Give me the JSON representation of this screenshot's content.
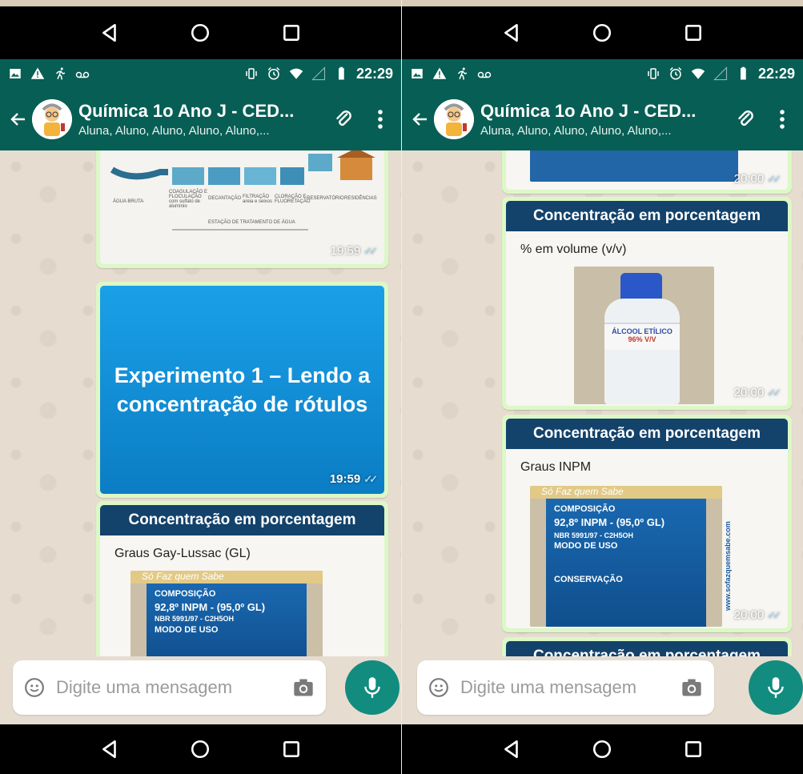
{
  "status": {
    "time": "22:29"
  },
  "chat": {
    "title": "Química 1o Ano J - CED...",
    "subtitle": "Aluna, Aluno, Aluno, Aluno, Aluno,..."
  },
  "left": {
    "messages": [
      {
        "time": "19:59",
        "diagram_labels": [
          "ÁGUA BRUTA",
          "COAGULAÇÃO E FLOCULAÇÃO com sulfato de alumínio",
          "DECANTAÇÃO",
          "FILTRAÇÃO areia e seixos",
          "CLORAÇÃO E FLUORETAÇÃO",
          "RESERVATÓRIO",
          "RESIDÊNCIAS",
          "ESTAÇÃO DE TRATAMENTO DE ÁGUA"
        ]
      },
      {
        "time": "19:59",
        "text_line1": "Experimento 1 – Lendo a",
        "text_line2": "concentração de rótulos"
      },
      {
        "heading": "Concentração em porcentagem",
        "body": "Graus Gay-Lussac (GL)",
        "photo_text_1": "Só Faz quem Sabe",
        "photo_text_2": "COMPOSIÇÃO",
        "photo_text_3": "92,8º INPM - (95,0º GL)",
        "photo_text_4": "NBR 5991/97 - C2H5OH",
        "photo_text_5": "MODO DE USO"
      }
    ]
  },
  "right": {
    "messages": [
      {
        "time": "20:00"
      },
      {
        "time": "20:00",
        "heading": "Concentração em porcentagem",
        "body": "% em volume (v/v)",
        "bottle_line1": "ÁLCOOL ETÍLICO",
        "bottle_line2": "96% V/V"
      },
      {
        "time": "20:00",
        "heading": "Concentração em porcentagem",
        "body": "Graus INPM",
        "photo_text_1": "Só Faz quem Sabe",
        "photo_text_2": "COMPOSIÇÃO",
        "photo_text_3": "92,8º INPM - (95,0º GL)",
        "photo_text_4": "NBR 5991/97 - C2H5OH",
        "photo_text_5": "MODO DE USO",
        "photo_text_6": "CONSERVAÇÃO",
        "side_text": "www.sofazquemsabe.com"
      },
      {
        "heading": "Concentração em porcentagem"
      }
    ]
  },
  "composer": {
    "placeholder": "Digite uma mensagem"
  },
  "colors": {
    "header": "#075e54",
    "bubble": "#dcf8c6",
    "fab": "#128c7e"
  }
}
